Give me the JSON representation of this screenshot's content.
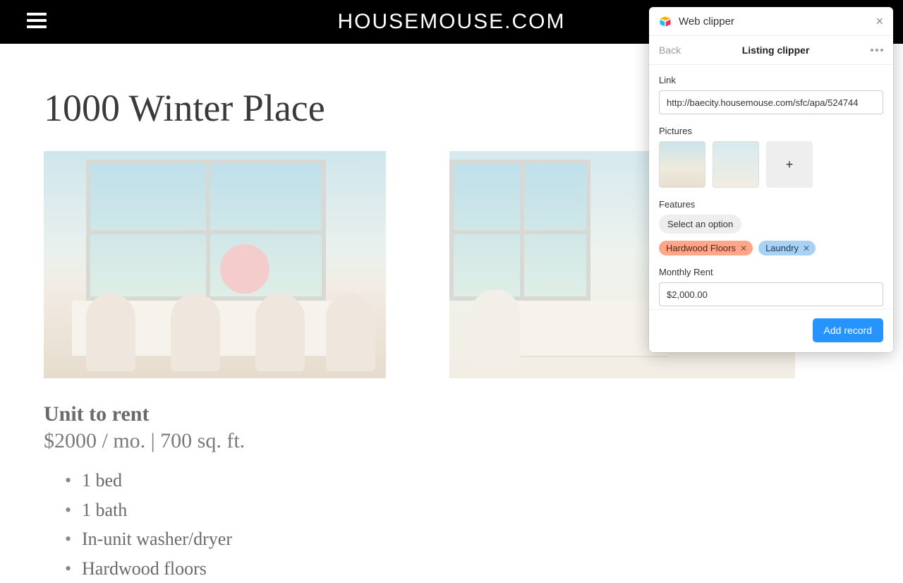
{
  "site": {
    "title": "HOUSEMOUSE.COM"
  },
  "listing": {
    "title": "1000 Winter Place",
    "subheading": "Unit to rent",
    "summary": "$2000 / mo. | 700 sq. ft.",
    "details": [
      "1 bed",
      "1 bath",
      "In-unit washer/dryer",
      "Hardwood floors"
    ]
  },
  "clipper": {
    "header_title": "Web clipper",
    "back_label": "Back",
    "subtitle": "Listing clipper",
    "fields": {
      "link_label": "Link",
      "link_value": "http://baecity.housemouse.com/sfc/apa/524744",
      "pictures_label": "Pictures",
      "add_picture_label": "+",
      "features_label": "Features",
      "select_option_label": "Select an option",
      "features_tags": [
        {
          "label": "Hardwood Floors",
          "color": "orange"
        },
        {
          "label": "Laundry",
          "color": "blue"
        }
      ],
      "rent_label": "Monthly Rent",
      "rent_value": "$2,000.00"
    },
    "footer": {
      "add_button": "Add record"
    }
  }
}
